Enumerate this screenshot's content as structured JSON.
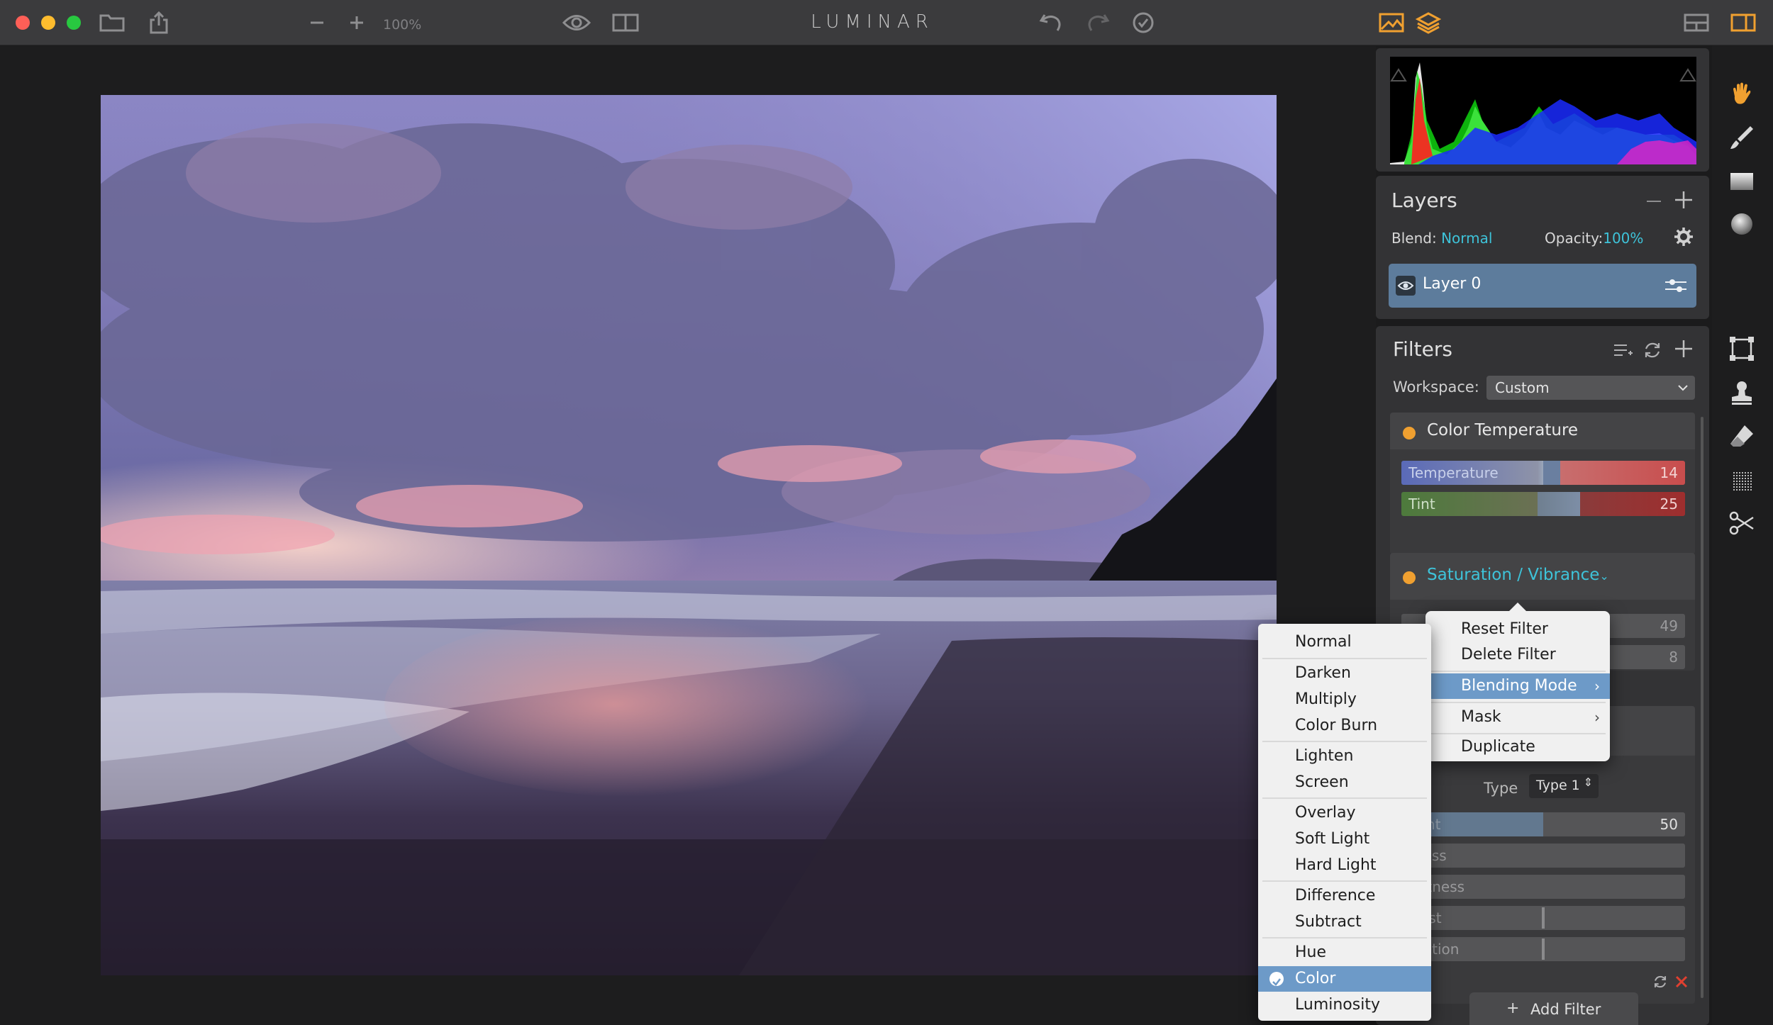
{
  "app": {
    "title": "LUMINAR"
  },
  "toolbar": {
    "zoom": "100%"
  },
  "layers": {
    "title": "Layers",
    "blend_label": "Blend:",
    "blend_value": "Normal",
    "opacity_label": "Opacity:",
    "opacity_value": "100%",
    "layer_name": "Layer 0"
  },
  "filters": {
    "title": "Filters",
    "workspace_label": "Workspace:",
    "workspace_value": "Custom",
    "color_temperature": {
      "title": "Color Temperature",
      "sliders": [
        {
          "label": "Temperature",
          "value": "14"
        },
        {
          "label": "Tint",
          "value": "25"
        }
      ]
    },
    "saturation_vibrance": {
      "title": "Saturation / Vibrance",
      "values": [
        "49",
        "8"
      ]
    },
    "third_filter": {
      "type_label": "Type",
      "type_value": "Type 1",
      "sliders": [
        {
          "label": "ount",
          "value": "50"
        },
        {
          "label": "tness",
          "value": ""
        },
        {
          "label": "ghtness",
          "value": ""
        },
        {
          "label": "trast",
          "value": ""
        },
        {
          "label": "uration",
          "value": ""
        }
      ]
    },
    "add_filter": "Add Filter"
  },
  "context_menu": {
    "items": [
      "Reset Filter",
      "Delete Filter",
      "Blending Mode",
      "Mask",
      "Duplicate"
    ],
    "selected": "Blending Mode"
  },
  "blend_menu": {
    "groups": [
      [
        "Normal"
      ],
      [
        "Darken",
        "Multiply",
        "Color Burn"
      ],
      [
        "Lighten",
        "Screen"
      ],
      [
        "Overlay",
        "Soft Light",
        "Hard Light"
      ],
      [
        "Difference",
        "Subtract"
      ],
      [
        "Hue",
        "Color",
        "Luminosity"
      ]
    ],
    "checked": "Color"
  },
  "colors": {
    "accent_teal": "#3ec3d9",
    "accent_orange": "#f0a030",
    "menu_highlight": "#6d9ac8"
  }
}
